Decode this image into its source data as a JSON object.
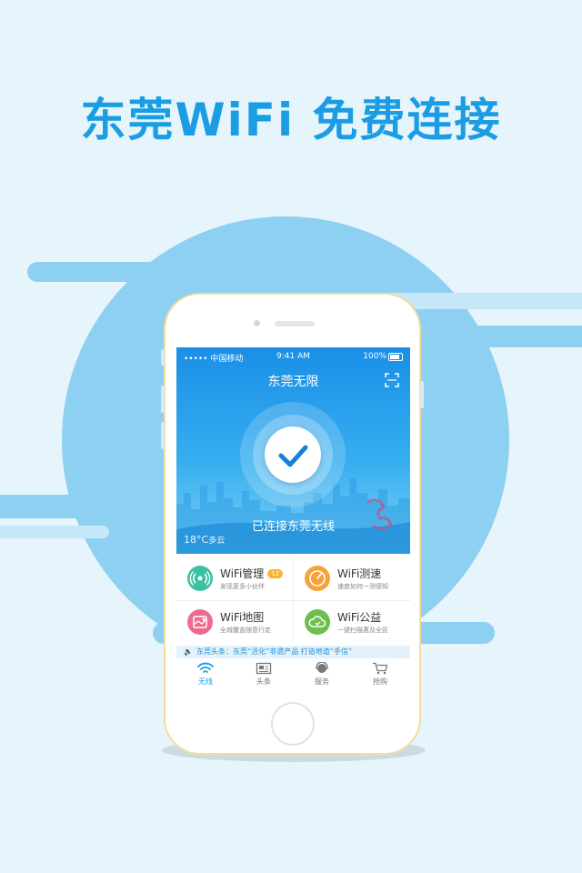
{
  "headline": "东莞WiFi  免费连接",
  "phone": {
    "status_bar": {
      "carrier": "••••• 中国移动",
      "time": "9:41 AM",
      "battery": "100%"
    },
    "app_title": "东莞无限",
    "connection_status": "已连接东莞无线",
    "weather": {
      "temp": "18°C",
      "condition": "多云"
    },
    "features": [
      {
        "title": "WiFi管理",
        "badge": "12",
        "subtitle": "发现更多小伙伴",
        "color": "#3cc0a3"
      },
      {
        "title": "WiFi测速",
        "subtitle": "速度如何一测便知",
        "color": "#f7a23b"
      },
      {
        "title": "WiFi地图",
        "subtitle": "全城覆盖随意行走",
        "color": "#ef6b8e"
      },
      {
        "title": "WiFi公益",
        "subtitle": "一键扫描惠及全民",
        "color": "#6cc04a"
      }
    ],
    "ticker": "东莞头条：东莞“活化”非遗产品 打造地道“手信”",
    "tabs": [
      {
        "label": "无线",
        "icon": "wifi-icon",
        "active": true
      },
      {
        "label": "头条",
        "icon": "newspaper-icon",
        "active": false
      },
      {
        "label": "服务",
        "icon": "headset-icon",
        "active": false
      },
      {
        "label": "抢购",
        "icon": "cart-icon",
        "active": false
      }
    ]
  },
  "colors": {
    "primary": "#1a9de3",
    "background": "#e6f4fc",
    "accent_circle": "#8ed0f2"
  }
}
